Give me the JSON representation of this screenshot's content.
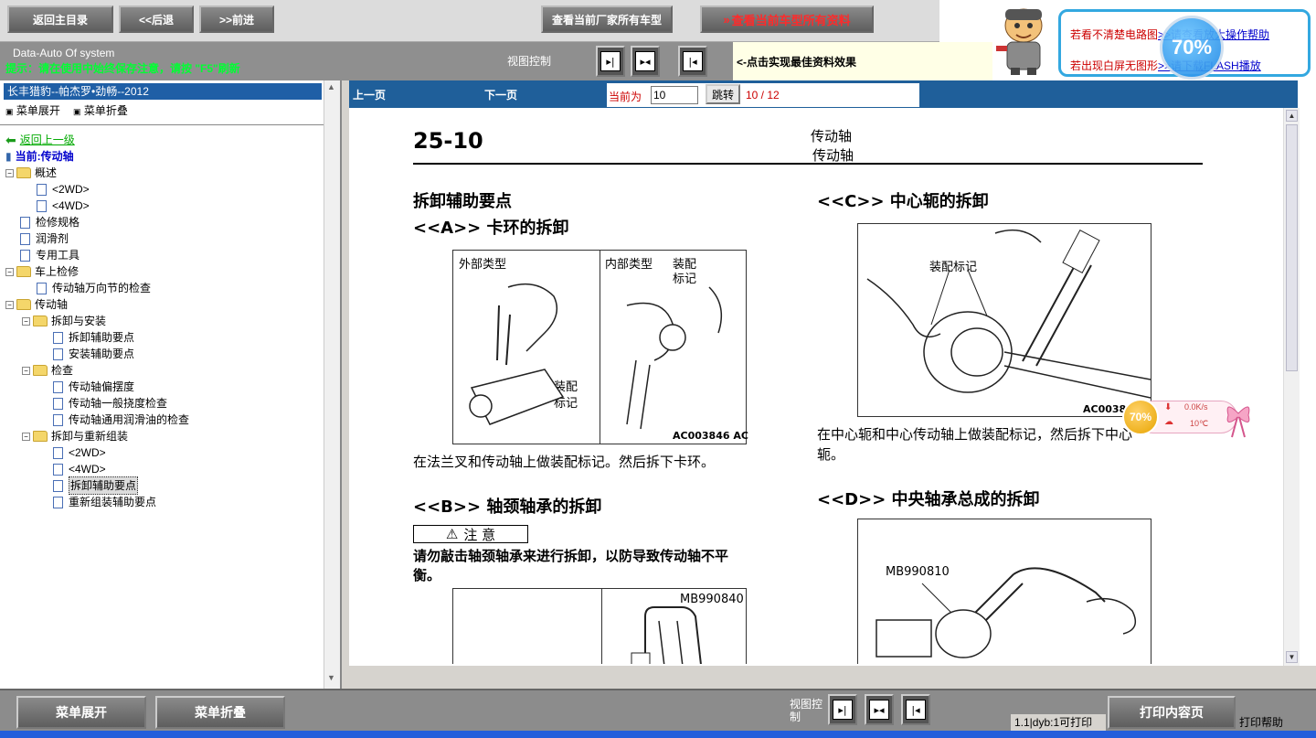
{
  "toolbar": {
    "home": "返回主目录",
    "back": "<<后退",
    "forward": ">>前进",
    "maker_models": "查看当前厂家所有车型",
    "model_data": "查看当前车型所有资料",
    "system_name": "Data-Auto Of system",
    "tip": "提示：请在使用中始终保存注意，请按 \"F5\"刷新",
    "view_control": "视图控制",
    "best_effect": "<-点击实现最佳资料效果"
  },
  "help": {
    "line1_prefix": "若看不清楚电路图",
    "line1_link": ">>请查看放大操作帮助",
    "line2_prefix": "若出现白屏无图形",
    "line2_link": ">>请下载FLASH播放",
    "badge": "70%"
  },
  "sidebar": {
    "title": "长丰猎豹--帕杰罗•劲畅--2012",
    "expand": "菜单展开",
    "collapse": "菜单折叠",
    "back_up": "返回上一级",
    "current": "当前:传动轴",
    "tree": [
      {
        "label": "概述",
        "type": "folder",
        "level": 0
      },
      {
        "label": "<2WD>",
        "type": "doc",
        "level": 1
      },
      {
        "label": "<4WD>",
        "type": "doc",
        "level": 1
      },
      {
        "label": "检修规格",
        "type": "doc",
        "level": 0
      },
      {
        "label": "润滑剂",
        "type": "doc",
        "level": 0
      },
      {
        "label": "专用工具",
        "type": "doc",
        "level": 0
      },
      {
        "label": "车上检修",
        "type": "folder",
        "level": 0
      },
      {
        "label": "传动轴万向节的检查",
        "type": "doc",
        "level": 1
      },
      {
        "label": "传动轴",
        "type": "folder",
        "level": 0
      },
      {
        "label": "拆卸与安装",
        "type": "folder",
        "level": 1
      },
      {
        "label": "拆卸辅助要点",
        "type": "doc",
        "level": 2
      },
      {
        "label": "安装辅助要点",
        "type": "doc",
        "level": 2
      },
      {
        "label": "检查",
        "type": "folder",
        "level": 1
      },
      {
        "label": "传动轴偏摆度",
        "type": "doc",
        "level": 2
      },
      {
        "label": "传动轴一般挠度检查",
        "type": "doc",
        "level": 2
      },
      {
        "label": "传动轴通用润滑油的检查",
        "type": "doc",
        "level": 2
      },
      {
        "label": "拆卸与重新组装",
        "type": "folder",
        "level": 1
      },
      {
        "label": "<2WD>",
        "type": "doc",
        "level": 2
      },
      {
        "label": "<4WD>",
        "type": "doc",
        "level": 2
      },
      {
        "label": "拆卸辅助要点",
        "type": "doc",
        "level": 2,
        "selected": true
      },
      {
        "label": "重新组装辅助要点",
        "type": "doc",
        "level": 2
      }
    ]
  },
  "pager": {
    "prev": "上一页",
    "next": "下一页",
    "current_label": "当前为",
    "page_value": "10",
    "jump": "跳转",
    "count": "10 / 12"
  },
  "document": {
    "page_number": "25-10",
    "header_1": "传动轴",
    "header_2": "传动轴",
    "heading_main": "拆卸辅助要点",
    "sec_a": "<<A>> 卡环的拆卸",
    "fig_a_outer": "外部类型",
    "fig_a_inner": "内部类型",
    "fig_a_mark1": "装配",
    "fig_a_mark2": "标记",
    "fig_a_mark3": "装配",
    "fig_a_mark4": "标记",
    "fig_a_code": "AC003846 AC",
    "text_a": "在法兰叉和传动轴上做装配标记。然后拆下卡环。",
    "sec_b": "<<B>> 轴颈轴承的拆卸",
    "caution": "注 意",
    "caution_text_1": "请勿敲击轴颈轴承来进行拆卸，以防导致传动轴不平",
    "caution_text_2": "衡。",
    "fig_b_code": "MB990840",
    "sec_c": "<<C>> 中心轭的拆卸",
    "fig_c_mark": "装配标记",
    "fig_c_code": "AC0038",
    "text_c_1": "在中心轭和中心传动轴上做装配标记，然后拆下中心",
    "text_c_2": "轭。",
    "sec_d": "<<D>> 中央轴承总成的拆卸",
    "fig_d_code": "MB990810"
  },
  "widget": {
    "percent": "70%",
    "speed": "0.0K/s",
    "temp": "10℃"
  },
  "bottom": {
    "expand": "菜单展开",
    "collapse": "菜单折叠",
    "view_control": "视图控制",
    "count": "1.1|dyb:1可打印",
    "print": "打印内容页",
    "print_help": "打印帮助"
  }
}
